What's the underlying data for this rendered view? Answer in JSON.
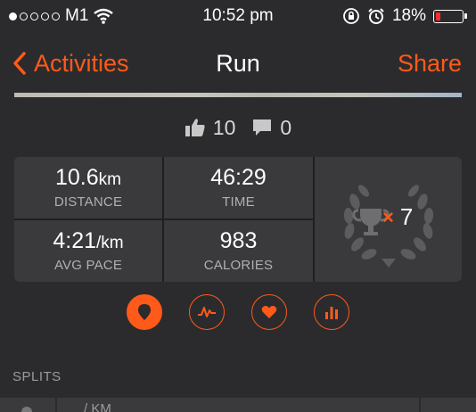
{
  "status_bar": {
    "carrier": "M1",
    "signal_full": 1,
    "signal_empty": 4,
    "time": "10:52 pm",
    "battery": "18%",
    "battery_level": 0.18
  },
  "nav": {
    "back_label": "Activities",
    "title": "Run",
    "share_label": "Share"
  },
  "social": {
    "kudos": "10",
    "comments": "0"
  },
  "stats": {
    "distance": {
      "value": "10.6",
      "unit": "km",
      "label": "DISTANCE"
    },
    "time": {
      "value": "46:29",
      "label": "TIME"
    },
    "avg_pace": {
      "value": "4:21",
      "unit": "/km",
      "label": "AVG PACE"
    },
    "calories": {
      "value": "983",
      "label": "CALORIES"
    },
    "achievements": {
      "count": "7",
      "multiplier": "×"
    }
  },
  "tabs": [
    {
      "name": "map",
      "icon": "map-pin-icon",
      "active": true
    },
    {
      "name": "pace",
      "icon": "pace-chart-icon",
      "active": false
    },
    {
      "name": "heart-rate",
      "icon": "heart-icon",
      "active": false
    },
    {
      "name": "splits",
      "icon": "bar-chart-icon",
      "active": false
    }
  ],
  "splits": {
    "section_label": "SPLITS",
    "column_header": "/ KM"
  },
  "colors": {
    "accent": "#ff5a1a",
    "background": "#2b2b2d",
    "panel": "#3a3a3c"
  }
}
